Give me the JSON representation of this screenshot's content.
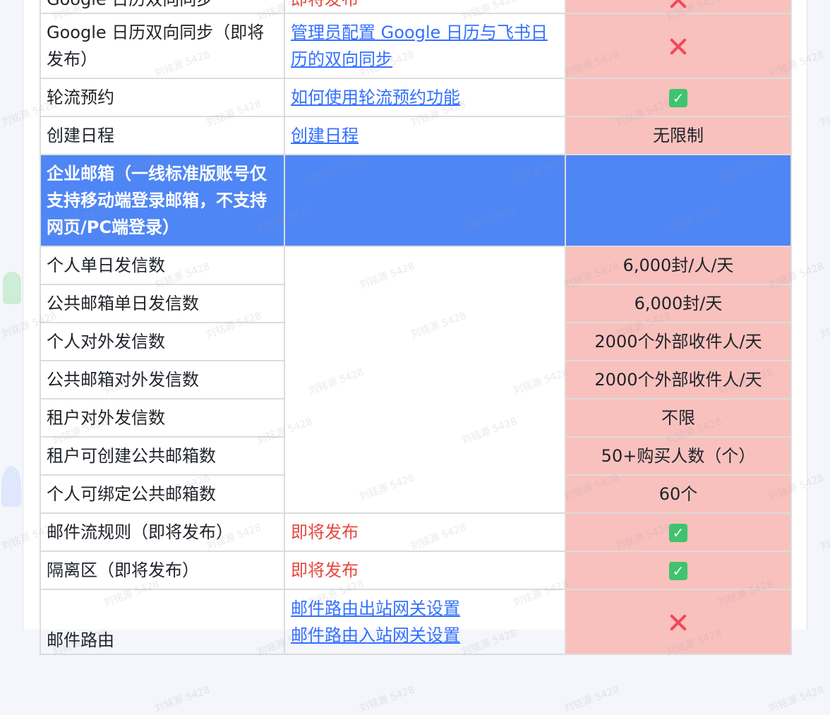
{
  "watermark": "刘铭源 5428",
  "rows": [
    {
      "feature": "Google 日历双向同步",
      "doc": "即将发布"
    },
    {
      "feature": "Google 日历双向同步（即将发布）",
      "doc_links": [
        "管理员配置 Google 日历与飞书日历的双向同步"
      ],
      "icon": "cross-icon"
    },
    {
      "feature": "轮流预约",
      "doc_links": [
        "如何使用轮流预约功能"
      ],
      "icon": "check-icon"
    },
    {
      "feature": "创建日程",
      "doc_links": [
        "创建日程"
      ],
      "value": "无限制"
    },
    {
      "section": "企业邮箱（一线标准版账号仅支持移动端登录邮箱，不支持网页/PC端登录）"
    },
    {
      "feature": "个人单日发信数",
      "value": "6,000封/人/天"
    },
    {
      "feature": "公共邮箱单日发信数",
      "value": "6,000封/天"
    },
    {
      "feature": "个人对外发信数",
      "value": "2000个外部收件人/天"
    },
    {
      "feature": "公共邮箱对外发信数",
      "value": "2000个外部收件人/天"
    },
    {
      "feature": "租户对外发信数",
      "value": "不限"
    },
    {
      "feature": "租户可创建公共邮箱数",
      "value": "50+购买人数（个）"
    },
    {
      "feature": "个人可绑定公共邮箱数",
      "value": "60个"
    },
    {
      "feature": "邮件流规则（即将发布）",
      "doc": "即将发布",
      "icon": "check-icon"
    },
    {
      "feature": "隔离区（即将发布）",
      "doc": "即将发布",
      "icon": "check-icon"
    },
    {
      "feature": "邮件路由",
      "doc_links": [
        "邮件路由出站网关设置",
        "邮件路由入站网关设置"
      ],
      "icon": "cross-icon"
    }
  ]
}
